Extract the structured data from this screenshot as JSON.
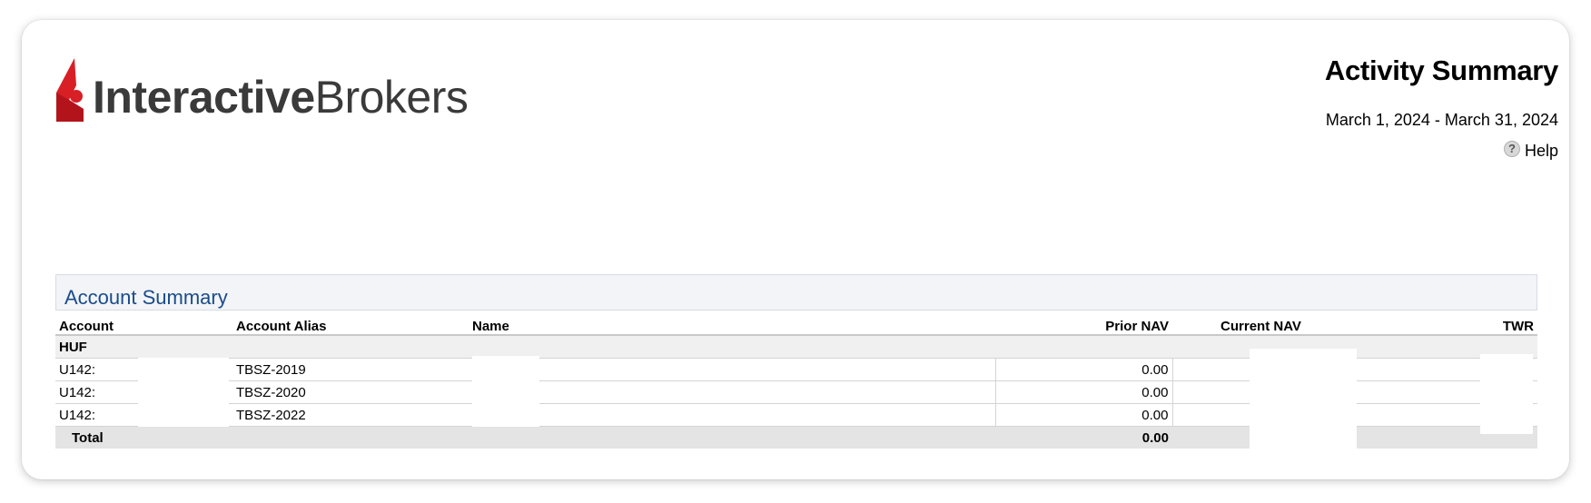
{
  "brand": {
    "logo_bold": "Interactive",
    "logo_regular": "Brokers",
    "logo_color": "#d81f26"
  },
  "report": {
    "title": "Activity Summary",
    "period": "March 1, 2024 - March 31, 2024",
    "help_label": "Help",
    "help_icon_glyph": "?"
  },
  "account_summary": {
    "section_title": "Account Summary",
    "columns": [
      "Account",
      "Account Alias",
      "Name",
      "Prior NAV",
      "Current NAV",
      "TWR"
    ],
    "group": "HUF",
    "rows": [
      {
        "account": "U142:",
        "alias": "TBSZ-2019",
        "name": "",
        "prior_nav": "0.00",
        "current_nav": "",
        "twr": ""
      },
      {
        "account": "U142:",
        "alias": "TBSZ-2020",
        "name": "",
        "prior_nav": "0.00",
        "current_nav": "",
        "twr": ""
      },
      {
        "account": "U142:",
        "alias": "TBSZ-2022",
        "name": "",
        "prior_nav": "0.00",
        "current_nav": "",
        "twr": ""
      }
    ],
    "total": {
      "label": "Total",
      "prior_nav": "0.00",
      "current_nav": "",
      "twr": ""
    }
  },
  "colors": {
    "section_title": "#1a4c8a",
    "section_bg": "#f2f4f7",
    "total_bg": "#e4e4e4"
  }
}
